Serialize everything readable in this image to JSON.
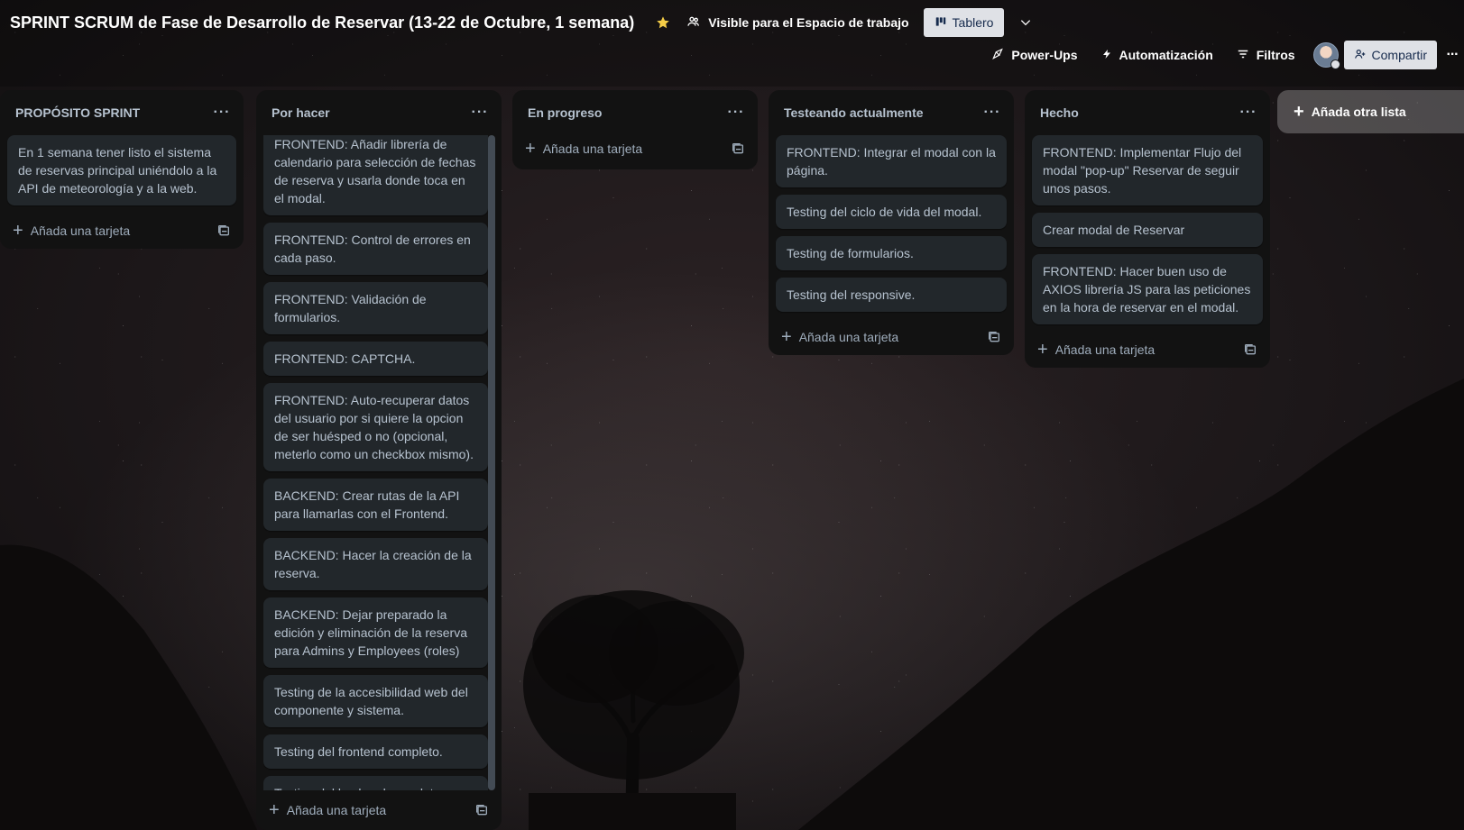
{
  "board": {
    "title": "SPRINT SCRUM de Fase de Desarrollo de Reservar (13-22 de Octubre, 1 semana)",
    "visibility": "Visible para el Espacio de trabajo",
    "view": "Tablero",
    "starred": true,
    "accent_star": "#f5cd47"
  },
  "header_actions": {
    "powerups": "Power-Ups",
    "automation": "Automatización",
    "filters": "Filtros",
    "share": "Compartir"
  },
  "add_card_label": "Añada una tarjeta",
  "add_list_label": "Añada otra lista",
  "lists": [
    {
      "title": "PROPÓSITO SPRINT",
      "cards": [
        "En 1 semana tener listo el sistema de reservas principal uniéndolo a la API de meteorología y a la web."
      ]
    },
    {
      "title": "Por hacer",
      "cards": [
        "FRONTEND: Añadir librería de calendario para selección de fechas de reserva y usarla donde toca en el modal.",
        "FRONTEND: Control de errores en cada paso.",
        "FRONTEND: Validación de formularios.",
        "FRONTEND: CAPTCHA.",
        "FRONTEND: Auto-recuperar datos del usuario por si quiere la opcion de ser huésped o no (opcional, meterlo como un checkbox mismo).",
        "BACKEND: Crear rutas de la API para llamarlas con el Frontend.",
        "BACKEND: Hacer la creación de la reserva.",
        "BACKEND: Dejar preparado la edición y eliminación de la reserva para Admins y Employees (roles)",
        "Testing de la accesibilidad web del componente y sistema.",
        "Testing del frontend completo.",
        "Testing del backend completo (funcionalidad en bdd y api)."
      ]
    },
    {
      "title": "En progreso",
      "cards": []
    },
    {
      "title": "Testeando actualmente",
      "cards": [
        "FRONTEND: Integrar el modal con la página.",
        "Testing del ciclo de vida del modal.",
        "Testing de formularios.",
        "Testing del responsive."
      ]
    },
    {
      "title": "Hecho",
      "cards": [
        "FRONTEND: Implementar Flujo del modal \"pop-up\" Reservar de seguir unos pasos.",
        "Crear modal de Reservar",
        "FRONTEND: Hacer buen uso de AXIOS librería JS para las peticiones en la hora de reservar en el modal."
      ]
    }
  ]
}
